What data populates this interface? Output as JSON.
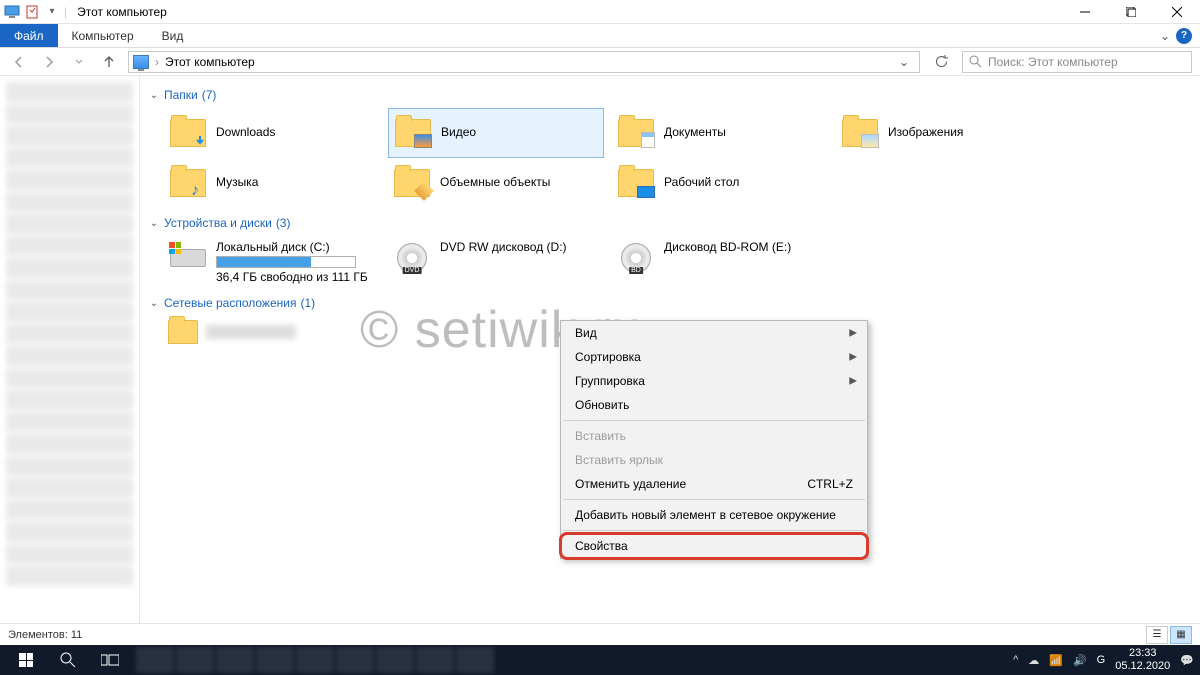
{
  "title": "Этот компьютер",
  "ribbon_tabs": {
    "file": "Файл",
    "computer": "Компьютер",
    "view": "Вид"
  },
  "breadcrumb": {
    "location": "Этот компьютер"
  },
  "search": {
    "placeholder": "Поиск: Этот компьютер"
  },
  "groups": {
    "folders": {
      "label": "Папки",
      "count": "(7)"
    },
    "devices": {
      "label": "Устройства и диски",
      "count": "(3)"
    },
    "network": {
      "label": "Сетевые расположения",
      "count": "(1)"
    }
  },
  "folders": [
    {
      "name": "Downloads"
    },
    {
      "name": "Видео"
    },
    {
      "name": "Документы"
    },
    {
      "name": "Изображения"
    },
    {
      "name": "Музыка"
    },
    {
      "name": "Объемные объекты"
    },
    {
      "name": "Рабочий стол"
    }
  ],
  "drives": [
    {
      "name": "Локальный диск (C:)",
      "usage_percent": 68,
      "subtext": "36,4 ГБ свободно из 111 ГБ"
    },
    {
      "name": "DVD RW дисковод (D:)",
      "badge": "DVD"
    },
    {
      "name": "Дисковод BD-ROM (E:)",
      "badge": "BD"
    }
  ],
  "context_menu": {
    "items": [
      {
        "label": "Вид",
        "submenu": true
      },
      {
        "label": "Сортировка",
        "submenu": true
      },
      {
        "label": "Группировка",
        "submenu": true
      },
      {
        "label": "Обновить"
      },
      {
        "sep": true
      },
      {
        "label": "Вставить",
        "disabled": true
      },
      {
        "label": "Вставить ярлык",
        "disabled": true
      },
      {
        "label": "Отменить удаление",
        "shortcut": "CTRL+Z"
      },
      {
        "sep": true
      },
      {
        "label": "Добавить новый элемент в сетевое окружение"
      },
      {
        "sep": true
      },
      {
        "label": "Свойства",
        "highlighted": true
      }
    ]
  },
  "statusbar": {
    "count_label": "Элементов:",
    "count_value": "11"
  },
  "watermark": "© setiwik.ru",
  "taskbar": {
    "lang": "G",
    "time": "23:33",
    "date": "05.12.2020"
  }
}
